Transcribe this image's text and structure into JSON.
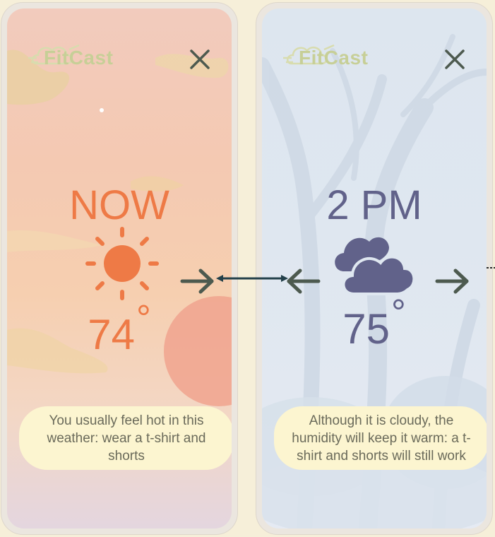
{
  "app": {
    "name": "FitCast"
  },
  "colors": {
    "background": "#f6efd9",
    "sunny_accent": "#ee7a46",
    "cloudy_accent": "#61628a",
    "arrow": "#4d5a4f",
    "advice_bg": "#fcf5d0"
  },
  "screens": [
    {
      "time_label": "NOW",
      "weather_icon": "sun-icon",
      "temperature": "74",
      "advice": "You usually feel hot in this weather: wear a t-shirt and shorts"
    },
    {
      "time_label": "2 PM",
      "weather_icon": "cloud-icon",
      "temperature": "75",
      "advice": "Although it is cloudy, the humidity will keep it warm: a t-shirt and shorts will still work"
    }
  ],
  "degree_symbol": "°"
}
